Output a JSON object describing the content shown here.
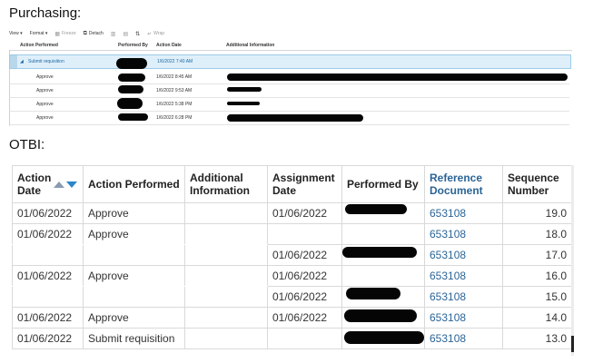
{
  "purchasing_label": "Purchasing:",
  "otbi_label": "OTBI:",
  "purchasing": {
    "toolbar": {
      "view": "View ▾",
      "format": "Format ▾",
      "freeze": "Freeze",
      "detach": "Detach",
      "wrap": "Wrap"
    },
    "columns": [
      "Action Performed",
      "Performed By",
      "Action Date",
      "Additional Information"
    ],
    "rows": [
      {
        "action": "Submit requisition",
        "date": "1/6/2022 7:40 AM"
      },
      {
        "action": "Approve",
        "date": "1/6/2022 8:45 AM"
      },
      {
        "action": "Approve",
        "date": "1/6/2022 9:53 AM"
      },
      {
        "action": "Approve",
        "date": "1/6/2022 5:38 PM"
      },
      {
        "action": "Approve",
        "date": "1/6/2022 6:28 PM"
      }
    ]
  },
  "otbi": {
    "columns": {
      "action_date": "Action Date",
      "action_performed": "Action Performed",
      "additional_info": "Additional Information",
      "assignment_date": "Assignment Date",
      "performed_by": "Performed By",
      "reference_document": "Reference Document",
      "sequence_number": "Sequence Number"
    },
    "rows": [
      {
        "action_date": "01/06/2022",
        "action": "Approve",
        "assignment_date": "01/06/2022",
        "ref": "653108",
        "seq": "19.0"
      },
      {
        "action_date": "01/06/2022",
        "action": "Approve",
        "assignment_date": "",
        "ref": "653108",
        "seq": "18.0"
      },
      {
        "action_date": "",
        "action": "",
        "assignment_date": "01/06/2022",
        "ref": "653108",
        "seq": "17.0"
      },
      {
        "action_date": "01/06/2022",
        "action": "Approve",
        "assignment_date": "01/06/2022",
        "ref": "653108",
        "seq": "16.0"
      },
      {
        "action_date": "",
        "action": "",
        "assignment_date": "01/06/2022",
        "ref": "653108",
        "seq": "15.0"
      },
      {
        "action_date": "01/06/2022",
        "action": "Approve",
        "assignment_date": "01/06/2022",
        "ref": "653108",
        "seq": "14.0"
      },
      {
        "action_date": "01/06/2022",
        "action": "Submit requisition",
        "assignment_date": "",
        "ref": "653108",
        "seq": "13.0"
      }
    ]
  },
  "colors": {
    "link": "#2a6496",
    "selected_row": "#dfeffa",
    "redaction": "#050505"
  }
}
